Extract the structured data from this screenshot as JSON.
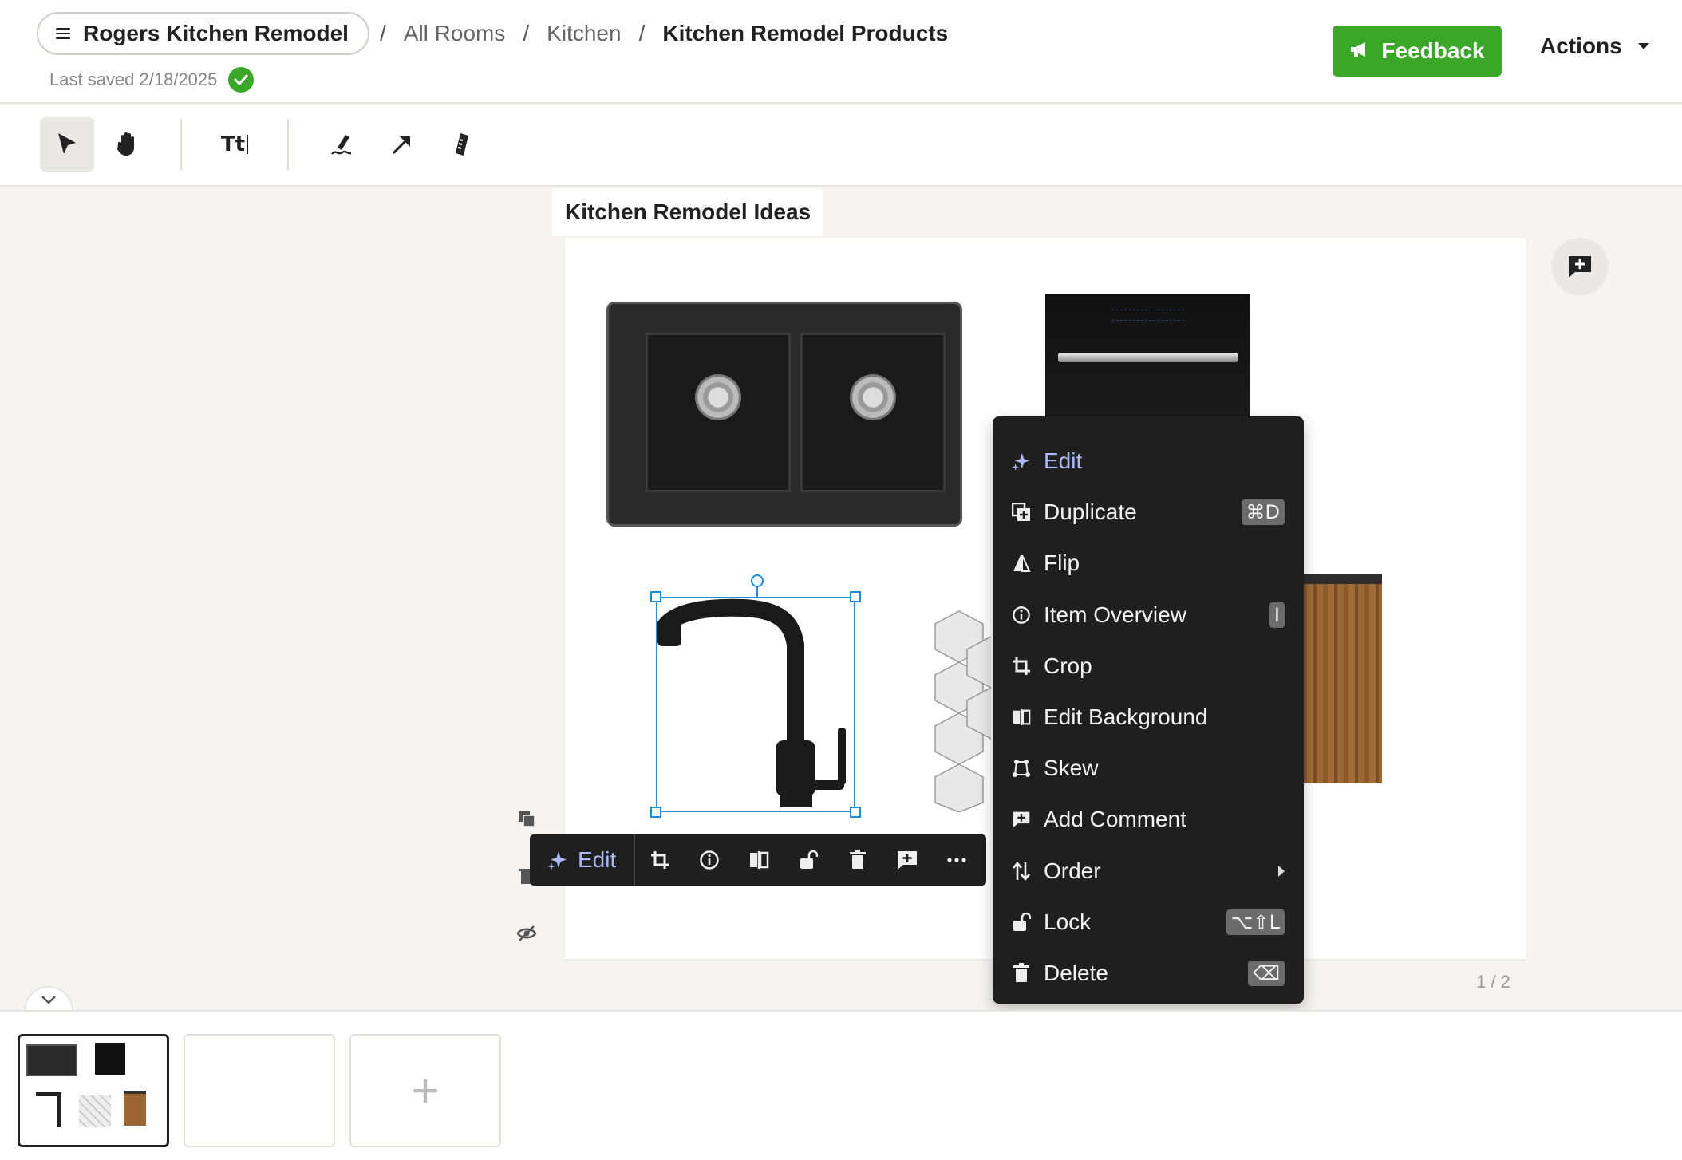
{
  "header": {
    "project_name": "Rogers Kitchen Remodel",
    "breadcrumbs": [
      "All Rooms",
      "Kitchen",
      "Kitchen Remodel Products"
    ],
    "breadcrumb_separator": "/",
    "last_saved": "Last saved 2/18/2025",
    "feedback_label": "Feedback",
    "actions_label": "Actions"
  },
  "toolbar": {
    "text_tool_label": "Tt"
  },
  "board": {
    "title": "Kitchen Remodel Ideas",
    "page_indicator": "1 / 2",
    "products": [
      "sink",
      "oven",
      "faucet",
      "tiles",
      "cabinet"
    ]
  },
  "float_bar": {
    "edit_label": "Edit"
  },
  "context_menu": {
    "items": [
      {
        "label": "Edit",
        "icon": "sparkle-icon",
        "shortcut": ""
      },
      {
        "label": "Duplicate",
        "icon": "duplicate-icon",
        "shortcut": "⌘D"
      },
      {
        "label": "Flip",
        "icon": "flip-icon",
        "shortcut": ""
      },
      {
        "label": "Item Overview",
        "icon": "info-icon",
        "shortcut": "I"
      },
      {
        "label": "Crop",
        "icon": "crop-icon",
        "shortcut": ""
      },
      {
        "label": "Edit Background",
        "icon": "background-icon",
        "shortcut": ""
      },
      {
        "label": "Skew",
        "icon": "skew-icon",
        "shortcut": ""
      },
      {
        "label": "Add Comment",
        "icon": "comment-icon",
        "shortcut": ""
      },
      {
        "label": "Order",
        "icon": "order-icon",
        "shortcut": ""
      },
      {
        "label": "Lock",
        "icon": "lock-icon",
        "shortcut": "⌥⇧L"
      },
      {
        "label": "Delete",
        "icon": "trash-icon",
        "shortcut": "⌫"
      }
    ]
  },
  "colors": {
    "accent_green": "#3aa728",
    "selection_blue": "#1b8fd6",
    "menu_bg": "#1f1f1f",
    "ai_purple": "#aeb8f5"
  }
}
